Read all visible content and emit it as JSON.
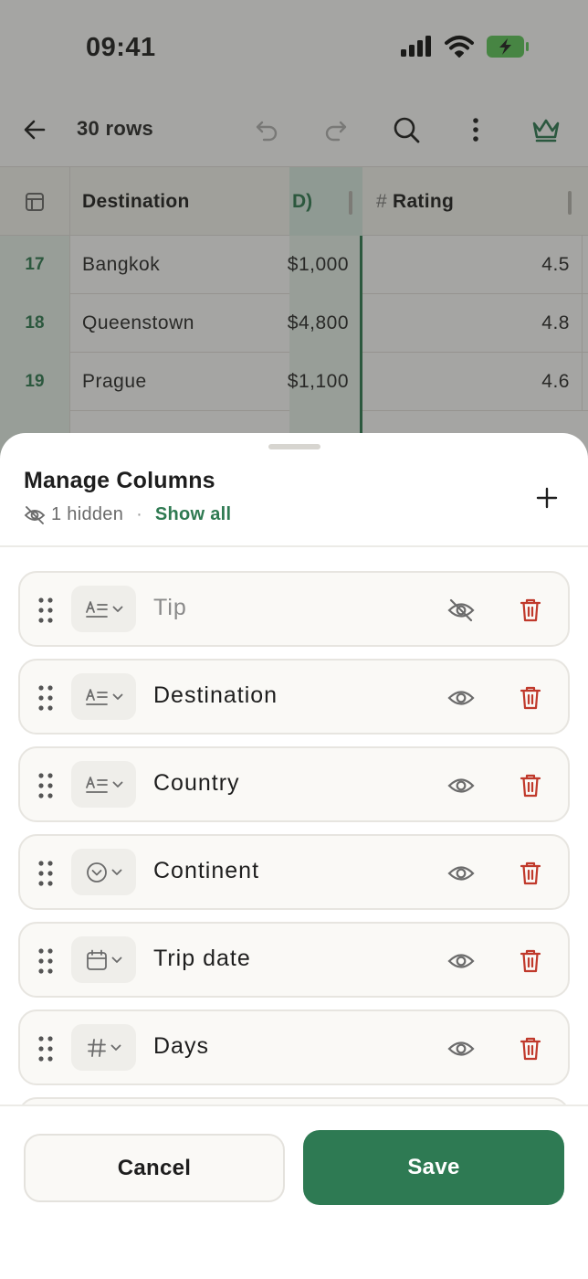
{
  "status_bar": {
    "time": "09:41",
    "icons": [
      "signal-icon",
      "wifi-icon",
      "battery-charging-icon"
    ]
  },
  "toolbar": {
    "row_count": "30 rows",
    "icons": [
      "back-arrow-icon",
      "undo-icon",
      "redo-icon",
      "search-icon",
      "more-vertical-icon",
      "crown-icon"
    ]
  },
  "grid": {
    "headers": {
      "destination": "Destination",
      "partial": "D)",
      "rating": "Rating",
      "rating_type_glyph": "#"
    },
    "rows": [
      {
        "num": "17",
        "destination": "Bangkok",
        "cost": "$1,000",
        "rating": "4.5"
      },
      {
        "num": "18",
        "destination": "Queenstown",
        "cost": "$4,800",
        "rating": "4.8"
      },
      {
        "num": "19",
        "destination": "Prague",
        "cost": "$1,100",
        "rating": "4.6"
      }
    ]
  },
  "sheet": {
    "title": "Manage Columns",
    "hidden_count": "1 hidden",
    "separator": "·",
    "show_all": "Show all",
    "columns": [
      {
        "name": "Tip",
        "type_icon": "text-type-icon",
        "visible": false
      },
      {
        "name": "Destination",
        "type_icon": "text-type-icon",
        "visible": true
      },
      {
        "name": "Country",
        "type_icon": "text-type-icon",
        "visible": true
      },
      {
        "name": "Continent",
        "type_icon": "select-type-icon",
        "visible": true
      },
      {
        "name": "Trip date",
        "type_icon": "date-type-icon",
        "visible": true
      },
      {
        "name": "Days",
        "type_icon": "number-type-icon",
        "visible": true
      }
    ],
    "cancel_label": "Cancel",
    "save_label": "Save"
  },
  "colors": {
    "accent": "#2E7A53",
    "accent_light": "#E8F3ED",
    "danger": "#C0392B",
    "text": "#1E1E1E",
    "muted": "#6B6B6B"
  }
}
